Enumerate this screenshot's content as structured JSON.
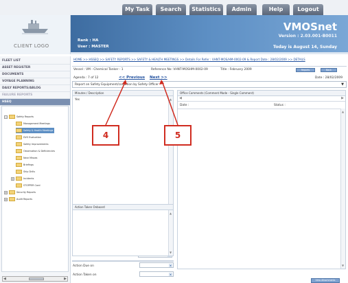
{
  "nav": {
    "tabs": [
      "My Task",
      "Search",
      "Statistics",
      "Admin",
      "Help",
      "Logout"
    ]
  },
  "header": {
    "app_name": "VMOSnet",
    "version": "Version : 2.03.001-B0011",
    "rank": "Rank : HA",
    "user": "User : MASTER",
    "date": "Today is August 14, Sunday",
    "client_logo": "CLIENT LOGO"
  },
  "sidebar": {
    "items": [
      "FLEET LIST",
      "ASSET REGISTER",
      "DOCUMENTS",
      "VOYAGE PLANNING",
      "DAILY REPORTS/ABLOG",
      "FAILURE REPORTS",
      "HSEQ"
    ],
    "tree": [
      "Safety Reports",
      "Management Meetings",
      "Safety & Health Meetings",
      "DVS Evaluation",
      "Safety Improvements",
      "Observation & Deficiencies",
      "Near Misses",
      "Briefings",
      "Ship Drills",
      "Incidents",
      "STOPPER Card",
      "Security Reports",
      "Audit Reports"
    ]
  },
  "breadcrumb": "HOME >> HSSEQ >> SAFETY REPORTS >> SAFETY & HEALTH MEETINGS >> Details For Refer : VHNT-MOS/HM-0002-09 & Report Date : 28/02/2009 >> DETAILS",
  "record": {
    "vessel": "Vessel : VM - Chemical Tanker - 1",
    "reference": "Reference No: VHNT-MOSHM-0002-09",
    "title": "Title : February 2009",
    "reports_btn": "Reports",
    "back_btn": "Back",
    "agenda": "Agenda : 7 of 12",
    "prev": "<< Previous",
    "next": "Next >>",
    "date": "Date : 28/02/2009",
    "topic": "Report on Safety Equipment/condition by Safety Officer"
  },
  "minutes": {
    "header": "Minutes / Description",
    "value": "Yes"
  },
  "office": {
    "header": "Office Comments (Comment Mode - Single Comment)",
    "date_label": "Date :",
    "status_label": "Status :"
  },
  "actions": {
    "req_vessel": "Action Required by Vessel ?",
    "req_office": "Action Required from Office ?",
    "select_no": "No",
    "taken_header": "Action Taken Onboard",
    "due_on": "Action Due on",
    "taken_on": "Action Taken on",
    "view_attachments": "View Attachments"
  },
  "callouts": {
    "four": "4",
    "five": "5"
  }
}
